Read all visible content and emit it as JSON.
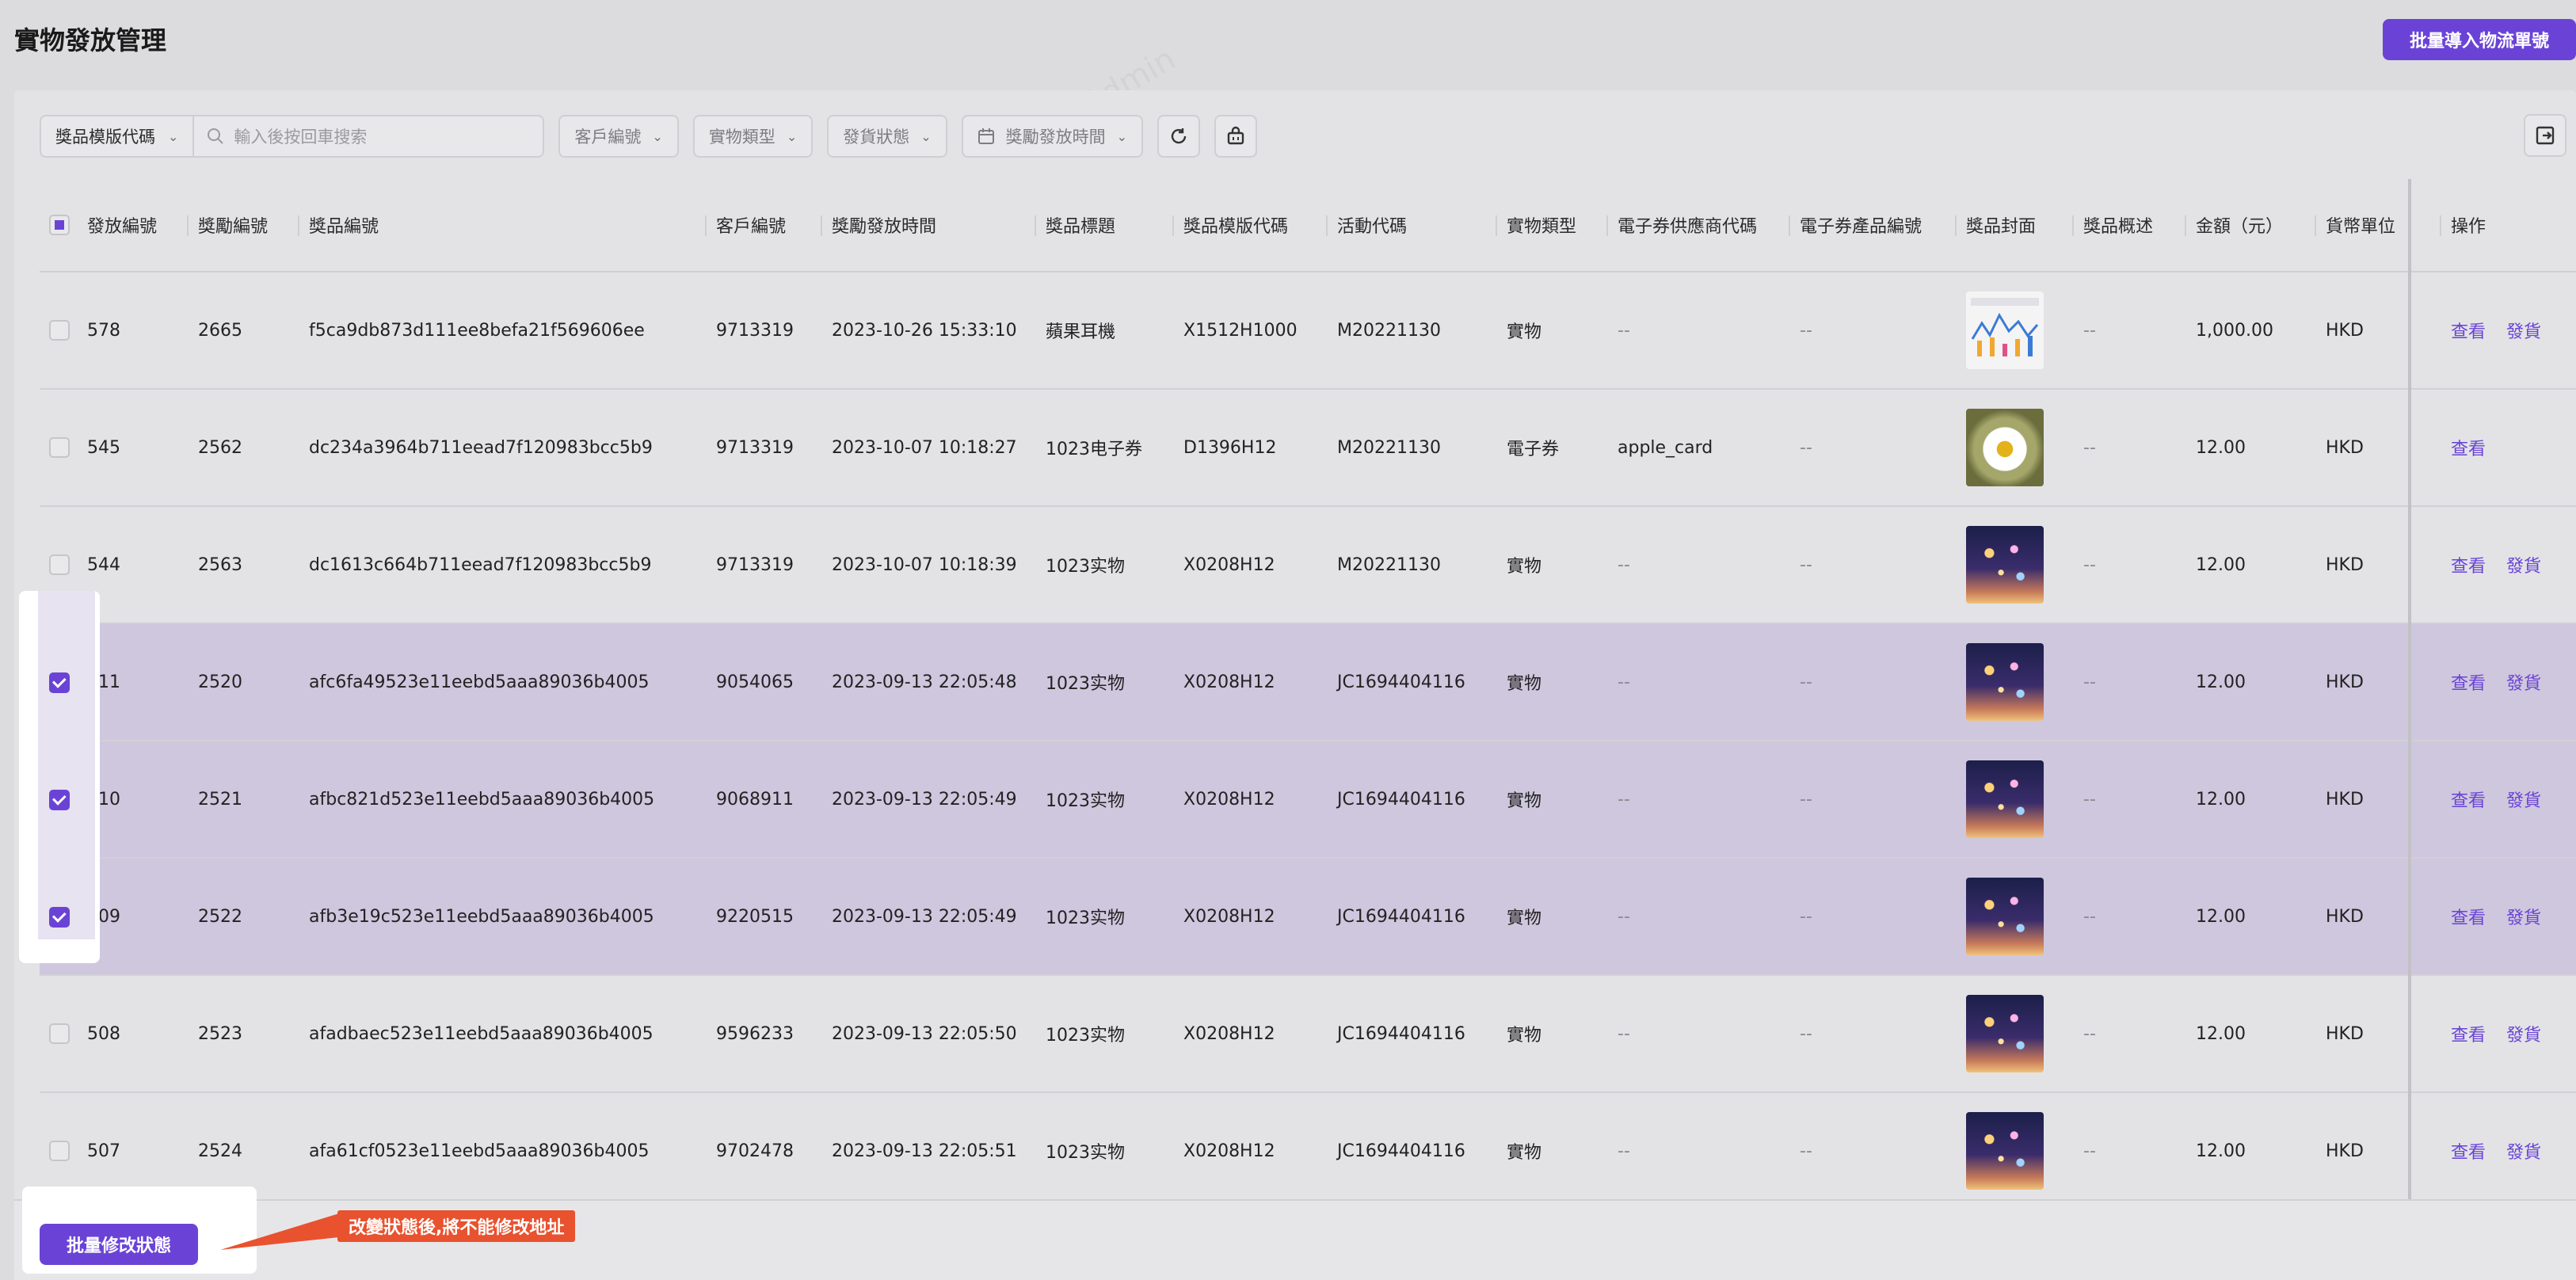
{
  "page": {
    "title": "實物發放管理"
  },
  "header": {
    "import_label": "批量導入物流單號"
  },
  "filters": {
    "template_select": "獎品模版代碼",
    "search_placeholder": "輸入後按回車搜索",
    "customer": "客戶編號",
    "type": "實物類型",
    "status": "發貨狀態",
    "time": "獎勵發放時間"
  },
  "table": {
    "columns": [
      "發放編號",
      "獎勵編號",
      "獎品編號",
      "客戶編號",
      "獎勵發放時間",
      "獎品標題",
      "獎品模版代碼",
      "活動代碼",
      "實物類型",
      "電子券供應商代碼",
      "電子券產品編號",
      "獎品封面",
      "獎品概述",
      "金額（元）",
      "貨幣單位",
      "操作"
    ],
    "rows": [
      {
        "selected": false,
        "id": "578",
        "reward": "2665",
        "prize": "f5ca9db873d111ee8befa21f569606ee",
        "customer": "9713319",
        "time": "2023-10-26 15:33:10",
        "title": "蘋果耳機",
        "template": "X1512H1000",
        "activity": "M20221130",
        "type": "實物",
        "vendor": "--",
        "product": "--",
        "cover": "chart",
        "summary": "--",
        "amount": "1,000.00",
        "currency": "HKD",
        "view": "查看",
        "ship": "發貨"
      },
      {
        "selected": false,
        "id": "545",
        "reward": "2562",
        "prize": "dc234a3964b711eead7f120983bcc5b9",
        "customer": "9713319",
        "time": "2023-10-07 10:18:27",
        "title": "1023电子券",
        "template": "D1396H12",
        "activity": "M20221130",
        "type": "電子券",
        "vendor": "apple_card",
        "product": "--",
        "cover": "flower",
        "summary": "--",
        "amount": "12.00",
        "currency": "HKD",
        "view": "查看",
        "ship": ""
      },
      {
        "selected": false,
        "id": "544",
        "reward": "2563",
        "prize": "dc1613c664b711eead7f120983bcc5b9",
        "customer": "9713319",
        "time": "2023-10-07 10:18:39",
        "title": "1023实物",
        "template": "X0208H12",
        "activity": "M20221130",
        "type": "實物",
        "vendor": "--",
        "product": "--",
        "cover": "fire",
        "summary": "--",
        "amount": "12.00",
        "currency": "HKD",
        "view": "查看",
        "ship": "發貨"
      },
      {
        "selected": true,
        "id": "511",
        "reward": "2520",
        "prize": "afc6fa49523e11eebd5aaa89036b4005",
        "customer": "9054065",
        "time": "2023-09-13 22:05:48",
        "title": "1023实物",
        "template": "X0208H12",
        "activity": "JC1694404116",
        "type": "實物",
        "vendor": "--",
        "product": "--",
        "cover": "fire",
        "summary": "--",
        "amount": "12.00",
        "currency": "HKD",
        "view": "查看",
        "ship": "發貨"
      },
      {
        "selected": true,
        "id": "510",
        "reward": "2521",
        "prize": "afbc821d523e11eebd5aaa89036b4005",
        "customer": "9068911",
        "time": "2023-09-13 22:05:49",
        "title": "1023实物",
        "template": "X0208H12",
        "activity": "JC1694404116",
        "type": "實物",
        "vendor": "--",
        "product": "--",
        "cover": "fire",
        "summary": "--",
        "amount": "12.00",
        "currency": "HKD",
        "view": "查看",
        "ship": "發貨"
      },
      {
        "selected": true,
        "id": "509",
        "reward": "2522",
        "prize": "afb3e19c523e11eebd5aaa89036b4005",
        "customer": "9220515",
        "time": "2023-09-13 22:05:49",
        "title": "1023实物",
        "template": "X0208H12",
        "activity": "JC1694404116",
        "type": "實物",
        "vendor": "--",
        "product": "--",
        "cover": "fire",
        "summary": "--",
        "amount": "12.00",
        "currency": "HKD",
        "view": "查看",
        "ship": "發貨"
      },
      {
        "selected": false,
        "id": "508",
        "reward": "2523",
        "prize": "afadbaec523e11eebd5aaa89036b4005",
        "customer": "9596233",
        "time": "2023-09-13 22:05:50",
        "title": "1023实物",
        "template": "X0208H12",
        "activity": "JC1694404116",
        "type": "實物",
        "vendor": "--",
        "product": "--",
        "cover": "fire",
        "summary": "--",
        "amount": "12.00",
        "currency": "HKD",
        "view": "查看",
        "ship": "發貨"
      },
      {
        "selected": false,
        "id": "507",
        "reward": "2524",
        "prize": "afa61cf0523e11eebd5aaa89036b4005",
        "customer": "9702478",
        "time": "2023-09-13 22:05:51",
        "title": "1023实物",
        "template": "X0208H12",
        "activity": "JC1694404116",
        "type": "實物",
        "vendor": "--",
        "product": "--",
        "cover": "fire",
        "summary": "--",
        "amount": "12.00",
        "currency": "HKD",
        "view": "查看",
        "ship": "發貨"
      }
    ]
  },
  "footer": {
    "batch_label": "批量修改狀態",
    "callout": "改變狀態後,將不能修改地址"
  },
  "watermark": "LongPort Test Admin",
  "colors": {
    "accent": "#6a43d6",
    "callout": "#e8522e"
  }
}
